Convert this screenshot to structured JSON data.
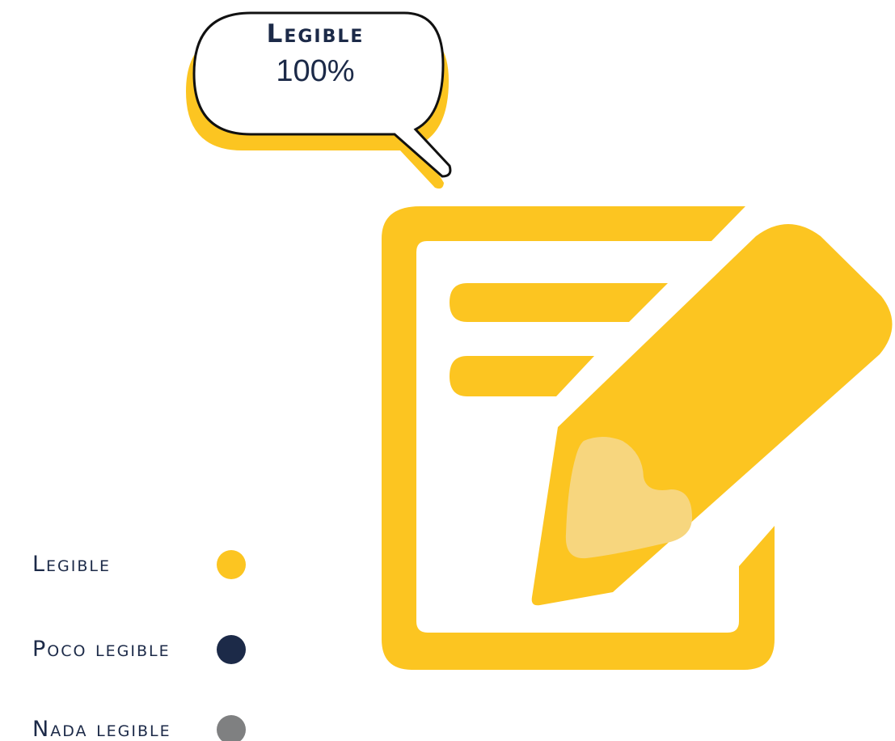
{
  "bubble": {
    "title": "Legible",
    "value": "100%"
  },
  "icon": {
    "name": "document-edit-icon",
    "color": "#fcc521",
    "highlight_color": "#f7d67e"
  },
  "legend": {
    "items": [
      {
        "label": "Legible",
        "color": "#fcc521"
      },
      {
        "label": "Poco legible",
        "color": "#1c2a48"
      },
      {
        "label": "Nada legible",
        "color": "#7f8081"
      }
    ]
  },
  "colors": {
    "text": "#1c2a48",
    "bubble_shadow": "#fcc521",
    "bubble_border": "#111111"
  }
}
